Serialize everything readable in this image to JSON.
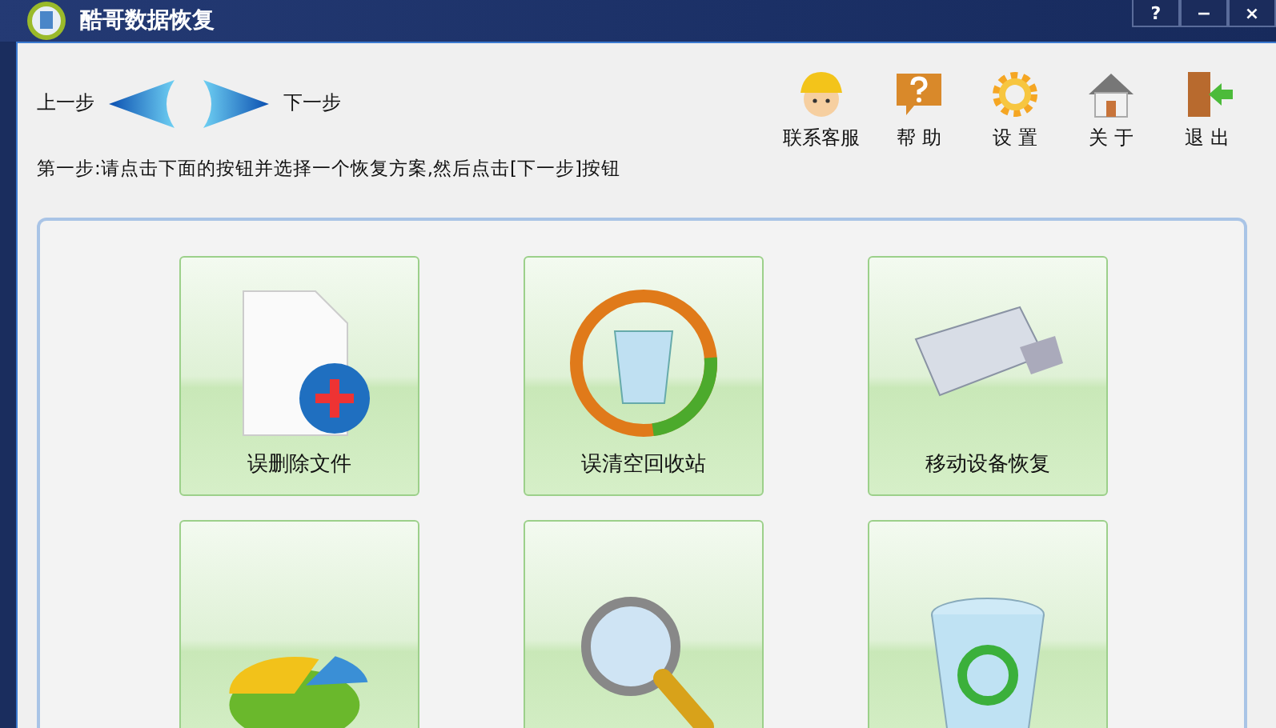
{
  "window": {
    "title": "酷哥数据恢复",
    "controls": [
      "?",
      "−",
      "×"
    ]
  },
  "nav": {
    "back": "上一步",
    "next": "下一步"
  },
  "toolbar": [
    {
      "kind": "support",
      "label": "联系客服"
    },
    {
      "kind": "help",
      "label": "帮 助"
    },
    {
      "kind": "settings",
      "label": "设 置"
    },
    {
      "kind": "about",
      "label": "关 于"
    },
    {
      "kind": "exit",
      "label": "退 出"
    }
  ],
  "instruction": "第一步:请点击下面的按钮并选择一个恢复方案,然后点击[下一步]按钮",
  "tiles": [
    {
      "kind": "file",
      "label": "误删除文件"
    },
    {
      "kind": "recycle",
      "label": "误清空回收站"
    },
    {
      "kind": "usb",
      "label": "移动设备恢复"
    },
    {
      "kind": "partition"
    },
    {
      "kind": "search"
    },
    {
      "kind": "trash"
    }
  ]
}
